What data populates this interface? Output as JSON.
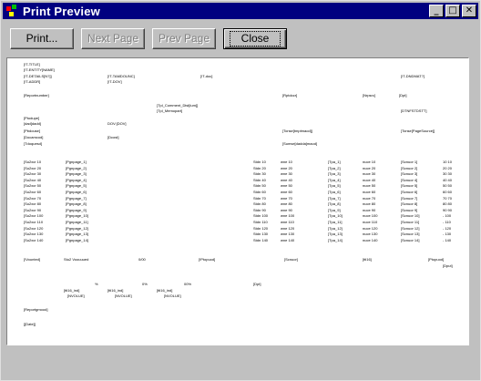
{
  "window": {
    "title": "Print Preview"
  },
  "titlebar_buttons": {
    "minimize": "_",
    "maximize": "□",
    "close": "✕"
  },
  "toolbar": {
    "print_label": "Print...",
    "next_label": "Next Page",
    "prev_label": "Prev Page",
    "close_label": "Close"
  },
  "report": {
    "header_lines": [
      "[!T-TITLE]",
      "[!T-ENTITY[NAME]",
      "[!T-DETAILS[N?]]",
      "[!T-ADDR]",
      "[!T-TAMDOUNC]",
      "[!T-DOV]",
      "[!T-doc]",
      "[!T-DNDMAT?]"
    ],
    "meta": [
      "[Reportnumber]",
      "[Rptdocr]",
      "[Nrpsrc]",
      "[Dpt]",
      "[Tpl_Comment_Dist[ium]]",
      "[Tpl_Memopart]",
      "[DTNFSTDSTT]",
      "[Ptodupe]",
      "[dad[dadd]",
      "DOV:[DOV]",
      "[Pbdouse]",
      "[Dcost]",
      "[Tonse[tmptmaod]]",
      "[Tonse[PageSource]]",
      "[Docamcod]",
      "[Sumse[dadda]maod]",
      "[Tdoquesd]"
    ],
    "table_rows": [
      {
        "a": "[Su2xcr 10",
        "b": "[Pgnpage_1]",
        "c": "Stdn 10",
        "d": "wne 10",
        "e": "[Tpa_1]",
        "f": "nuce 10",
        "g": "[Scnuor 1]",
        "h": "10 10"
      },
      {
        "a": "[Su2xcr 20",
        "b": "[Pgnpage_2]",
        "c": "Stdn 20",
        "d": "wne 20",
        "e": "[Tpa_2]",
        "f": "nuce 20",
        "g": "[Scnuor 2]",
        "h": "20 20"
      },
      {
        "a": "[Su2xcr 30",
        "b": "[Pgnpage_3]",
        "c": "Stdn 30",
        "d": "wne 30",
        "e": "[Tpa_3]",
        "f": "nuce 30",
        "g": "[Scnuor 3]",
        "h": "30 30"
      },
      {
        "a": "[Su2xcr 40",
        "b": "[Pgnpage_4]",
        "c": "Stdn 40",
        "d": "wne 40",
        "e": "[Tpa_4]",
        "f": "nuce 40",
        "g": "[Scnuor 4]",
        "h": "40 40"
      },
      {
        "a": "[Su2xcr 50",
        "b": "[Pgnpage_5]",
        "c": "Stdn 50",
        "d": "wne 50",
        "e": "[Tpa_5]",
        "f": "nuce 50",
        "g": "[Scnuor 5]",
        "h": "50 50"
      },
      {
        "a": "[Su2xcr 60",
        "b": "[Pgnpage_6]",
        "c": "Stdn 60",
        "d": "wne 60",
        "e": "[Tpa_6]",
        "f": "nuce 60",
        "g": "[Scnuor 6]",
        "h": "60 60"
      },
      {
        "a": "[Su2xcr 70",
        "b": "[Pgnpage_7]",
        "c": "Stdn 70",
        "d": "wne 70",
        "e": "[Tpa_7]",
        "f": "nuce 70",
        "g": "[Scnuor 7]",
        "h": "70 70"
      },
      {
        "a": "[Su2xcr 80",
        "b": "[Pgnpage_8]",
        "c": "Stdn 80",
        "d": "wne 80",
        "e": "[Tpa_8]",
        "f": "nuce 80",
        "g": "[Scnuor 8]",
        "h": "80 80"
      },
      {
        "a": "[Su2xcr 90",
        "b": "[Pgnpage_9]",
        "c": "Stdn 90",
        "d": "wne 90",
        "e": "[Tpa_9]",
        "f": "nuce 90",
        "g": "[Scnuor 9]",
        "h": "90 90"
      },
      {
        "a": "[Su2xcr 100",
        "b": "[Pgnpage_10]",
        "c": "Stdn 100",
        "d": "wne 100",
        "e": "[Tpa_10]",
        "f": "nuce 100",
        "g": "[Scnuor 10]",
        "h": "- 100"
      },
      {
        "a": "[Su2xcr 110",
        "b": "[Pgnpage_11]",
        "c": "Stdn 110",
        "d": "wne 110",
        "e": "[Tpa_11]",
        "f": "nuce 110",
        "g": "[Scnuor 11]",
        "h": "- 110"
      },
      {
        "a": "[Su2xcr 120",
        "b": "[Pgnpage_12]",
        "c": "Stdn 120",
        "d": "wne 120",
        "e": "[Tpa_12]",
        "f": "nuce 120",
        "g": "[Scnuor 12]",
        "h": "- 120"
      },
      {
        "a": "[Su2xcr 130",
        "b": "[Pgnpage_13]",
        "c": "Stdn 130",
        "d": "wne 130",
        "e": "[Tpa_13]",
        "f": "nuce 130",
        "g": "[Scnuor 13]",
        "h": "- 130"
      },
      {
        "a": "[Su2xcr 140",
        "b": "[Pgnpage_14]",
        "c": "Stdn 140",
        "d": "wne 140",
        "e": "[Tpa_14]",
        "f": "nuce 140",
        "g": "[Scnuor 14]",
        "h": "- 140"
      }
    ],
    "footer": [
      "[!Vounted]",
      "Stu2 Voouuued",
      "0/00",
      "[!Ptopuod]",
      "[Scnuor]",
      "[ttl16]",
      "[Ptopuod]",
      "[Dput]",
      "[Dpt]",
      "%",
      "0%",
      "00%",
      "[ttl16_ind]",
      "[ttl16_ind]",
      "[ttl16_ind]",
      "[NVOLUE]",
      "[NVOLUE]",
      "[NVOLUE]",
      "[Reportgmood]",
      "[[Date]]"
    ]
  }
}
